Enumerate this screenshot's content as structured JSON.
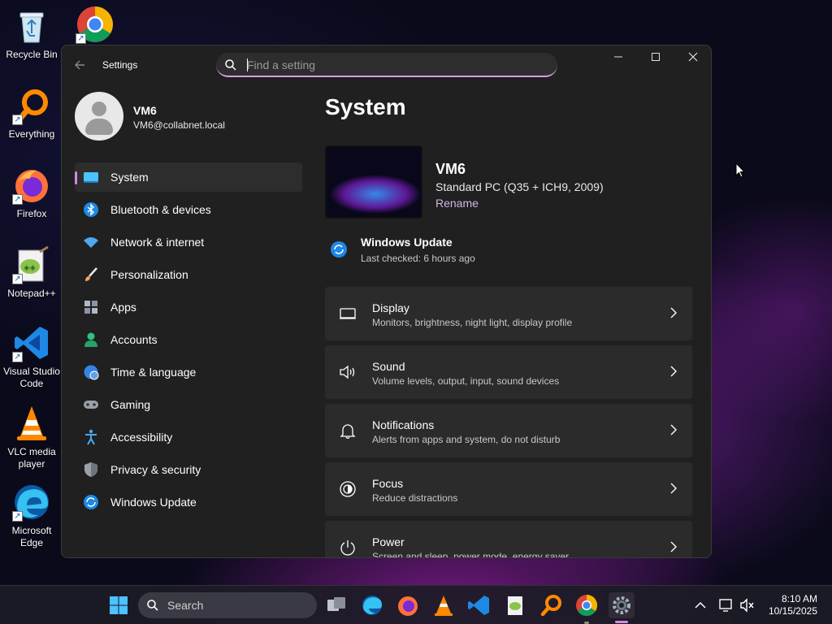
{
  "desktop": {
    "icons": [
      {
        "label_line1": "Recycle Bin",
        "label_line2": "",
        "icon": "recycle-bin-icon"
      },
      {
        "label_line1": "Everything",
        "label_line2": "",
        "icon": "everything-search-icon"
      },
      {
        "label_line1": "Firefox",
        "label_line2": "",
        "icon": "firefox-icon"
      },
      {
        "label_line1": "Notepad++",
        "label_line2": "",
        "icon": "notepad-plus-plus-icon"
      },
      {
        "label_line1": "Visual Studio",
        "label_line2": "Code",
        "icon": "vscode-icon"
      },
      {
        "label_line1": "VLC media",
        "label_line2": "player",
        "icon": "vlc-icon"
      },
      {
        "label_line1": "Microsoft",
        "label_line2": "Edge",
        "icon": "edge-icon"
      },
      {
        "label_line1": "",
        "label_line2": "",
        "icon": "chrome-icon"
      }
    ]
  },
  "window": {
    "app_title": "Settings",
    "search": {
      "placeholder": "Find a setting",
      "value": ""
    },
    "profile": {
      "name": "VM6",
      "email": "VM6@collabnet.local"
    },
    "nav": [
      {
        "label": "System",
        "icon": "system-display-icon",
        "active": true
      },
      {
        "label": "Bluetooth & devices",
        "icon": "bluetooth-icon",
        "active": false
      },
      {
        "label": "Network & internet",
        "icon": "wifi-icon",
        "active": false
      },
      {
        "label": "Personalization",
        "icon": "paintbrush-icon",
        "active": false
      },
      {
        "label": "Apps",
        "icon": "apps-icon",
        "active": false
      },
      {
        "label": "Accounts",
        "icon": "accounts-icon",
        "active": false
      },
      {
        "label": "Time & language",
        "icon": "globe-clock-icon",
        "active": false
      },
      {
        "label": "Gaming",
        "icon": "gamepad-icon",
        "active": false
      },
      {
        "label": "Accessibility",
        "icon": "accessibility-icon",
        "active": false
      },
      {
        "label": "Privacy & security",
        "icon": "shield-icon",
        "active": false
      },
      {
        "label": "Windows Update",
        "icon": "windows-update-icon",
        "active": false
      }
    ],
    "main": {
      "page_title": "System",
      "device": {
        "name": "VM6",
        "model": "Standard PC (Q35 + ICH9, 2009)",
        "rename_link": "Rename"
      },
      "windows_update": {
        "title": "Windows Update",
        "subtitle": "Last checked: 6 hours ago"
      },
      "cards": [
        {
          "title": "Display",
          "subtitle": "Monitors, brightness, night light, display profile",
          "icon": "monitor-icon"
        },
        {
          "title": "Sound",
          "subtitle": "Volume levels, output, input, sound devices",
          "icon": "speaker-icon"
        },
        {
          "title": "Notifications",
          "subtitle": "Alerts from apps and system, do not disturb",
          "icon": "bell-icon"
        },
        {
          "title": "Focus",
          "subtitle": "Reduce distractions",
          "icon": "focus-icon"
        },
        {
          "title": "Power",
          "subtitle": "Screen and sleep, power mode, energy saver",
          "icon": "power-icon"
        }
      ]
    }
  },
  "taskbar": {
    "search_label": "Search",
    "time": "8:10 AM",
    "date": "10/15/2025"
  },
  "colors": {
    "accent": "#d08be2",
    "window_bg": "#202020",
    "card_bg": "#2b2b2b",
    "link": "#d5b4e6"
  }
}
